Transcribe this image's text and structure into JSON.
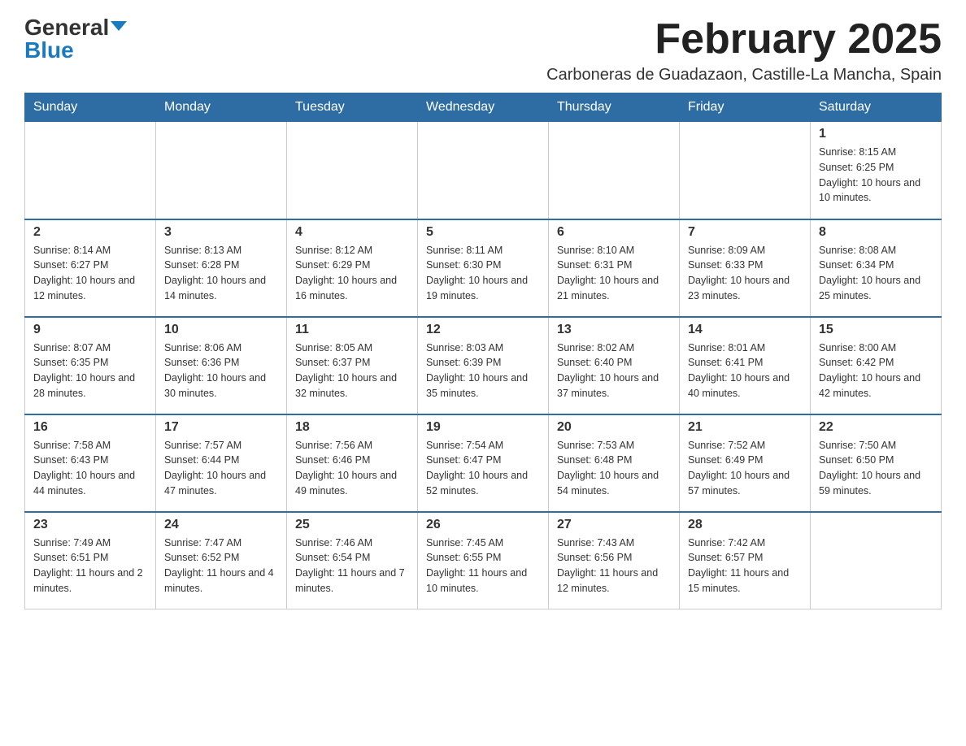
{
  "logo": {
    "general": "General",
    "blue": "Blue"
  },
  "title": "February 2025",
  "location": "Carboneras de Guadazaon, Castille-La Mancha, Spain",
  "days_of_week": [
    "Sunday",
    "Monday",
    "Tuesday",
    "Wednesday",
    "Thursday",
    "Friday",
    "Saturday"
  ],
  "weeks": [
    [
      {
        "day": "",
        "info": ""
      },
      {
        "day": "",
        "info": ""
      },
      {
        "day": "",
        "info": ""
      },
      {
        "day": "",
        "info": ""
      },
      {
        "day": "",
        "info": ""
      },
      {
        "day": "",
        "info": ""
      },
      {
        "day": "1",
        "info": "Sunrise: 8:15 AM\nSunset: 6:25 PM\nDaylight: 10 hours and 10 minutes."
      }
    ],
    [
      {
        "day": "2",
        "info": "Sunrise: 8:14 AM\nSunset: 6:27 PM\nDaylight: 10 hours and 12 minutes."
      },
      {
        "day": "3",
        "info": "Sunrise: 8:13 AM\nSunset: 6:28 PM\nDaylight: 10 hours and 14 minutes."
      },
      {
        "day": "4",
        "info": "Sunrise: 8:12 AM\nSunset: 6:29 PM\nDaylight: 10 hours and 16 minutes."
      },
      {
        "day": "5",
        "info": "Sunrise: 8:11 AM\nSunset: 6:30 PM\nDaylight: 10 hours and 19 minutes."
      },
      {
        "day": "6",
        "info": "Sunrise: 8:10 AM\nSunset: 6:31 PM\nDaylight: 10 hours and 21 minutes."
      },
      {
        "day": "7",
        "info": "Sunrise: 8:09 AM\nSunset: 6:33 PM\nDaylight: 10 hours and 23 minutes."
      },
      {
        "day": "8",
        "info": "Sunrise: 8:08 AM\nSunset: 6:34 PM\nDaylight: 10 hours and 25 minutes."
      }
    ],
    [
      {
        "day": "9",
        "info": "Sunrise: 8:07 AM\nSunset: 6:35 PM\nDaylight: 10 hours and 28 minutes."
      },
      {
        "day": "10",
        "info": "Sunrise: 8:06 AM\nSunset: 6:36 PM\nDaylight: 10 hours and 30 minutes."
      },
      {
        "day": "11",
        "info": "Sunrise: 8:05 AM\nSunset: 6:37 PM\nDaylight: 10 hours and 32 minutes."
      },
      {
        "day": "12",
        "info": "Sunrise: 8:03 AM\nSunset: 6:39 PM\nDaylight: 10 hours and 35 minutes."
      },
      {
        "day": "13",
        "info": "Sunrise: 8:02 AM\nSunset: 6:40 PM\nDaylight: 10 hours and 37 minutes."
      },
      {
        "day": "14",
        "info": "Sunrise: 8:01 AM\nSunset: 6:41 PM\nDaylight: 10 hours and 40 minutes."
      },
      {
        "day": "15",
        "info": "Sunrise: 8:00 AM\nSunset: 6:42 PM\nDaylight: 10 hours and 42 minutes."
      }
    ],
    [
      {
        "day": "16",
        "info": "Sunrise: 7:58 AM\nSunset: 6:43 PM\nDaylight: 10 hours and 44 minutes."
      },
      {
        "day": "17",
        "info": "Sunrise: 7:57 AM\nSunset: 6:44 PM\nDaylight: 10 hours and 47 minutes."
      },
      {
        "day": "18",
        "info": "Sunrise: 7:56 AM\nSunset: 6:46 PM\nDaylight: 10 hours and 49 minutes."
      },
      {
        "day": "19",
        "info": "Sunrise: 7:54 AM\nSunset: 6:47 PM\nDaylight: 10 hours and 52 minutes."
      },
      {
        "day": "20",
        "info": "Sunrise: 7:53 AM\nSunset: 6:48 PM\nDaylight: 10 hours and 54 minutes."
      },
      {
        "day": "21",
        "info": "Sunrise: 7:52 AM\nSunset: 6:49 PM\nDaylight: 10 hours and 57 minutes."
      },
      {
        "day": "22",
        "info": "Sunrise: 7:50 AM\nSunset: 6:50 PM\nDaylight: 10 hours and 59 minutes."
      }
    ],
    [
      {
        "day": "23",
        "info": "Sunrise: 7:49 AM\nSunset: 6:51 PM\nDaylight: 11 hours and 2 minutes."
      },
      {
        "day": "24",
        "info": "Sunrise: 7:47 AM\nSunset: 6:52 PM\nDaylight: 11 hours and 4 minutes."
      },
      {
        "day": "25",
        "info": "Sunrise: 7:46 AM\nSunset: 6:54 PM\nDaylight: 11 hours and 7 minutes."
      },
      {
        "day": "26",
        "info": "Sunrise: 7:45 AM\nSunset: 6:55 PM\nDaylight: 11 hours and 10 minutes."
      },
      {
        "day": "27",
        "info": "Sunrise: 7:43 AM\nSunset: 6:56 PM\nDaylight: 11 hours and 12 minutes."
      },
      {
        "day": "28",
        "info": "Sunrise: 7:42 AM\nSunset: 6:57 PM\nDaylight: 11 hours and 15 minutes."
      },
      {
        "day": "",
        "info": ""
      }
    ]
  ]
}
